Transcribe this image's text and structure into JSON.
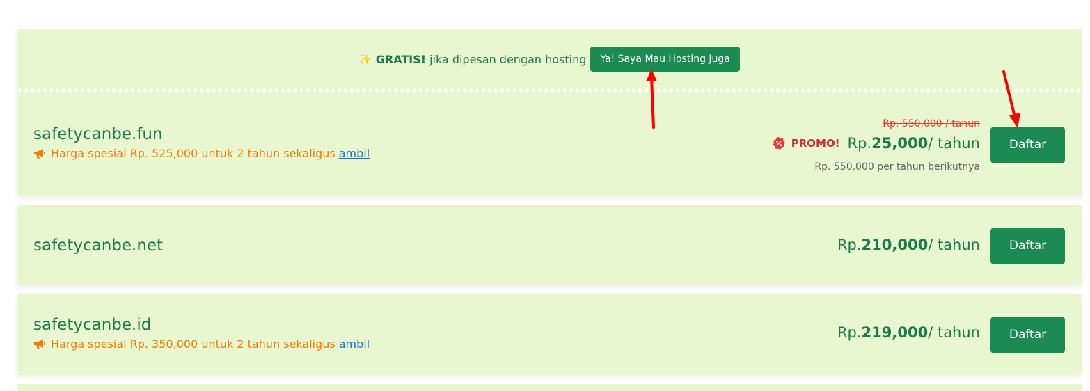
{
  "banner": {
    "icon": "sparkles-icon",
    "highlight": "GRATIS!",
    "text": "jika dipesan dengan hosting",
    "button_label": "Ya! Saya Mau Hosting Juga"
  },
  "domains": [
    {
      "name": "safetycanbe.fun",
      "special_text": "Harga spesial Rp. 525,000 untuk 2 tahun sekaligus",
      "special_link": "ambil",
      "old_price": "Rp. 550,000 / tahun",
      "promo_label": "PROMO!",
      "price_prefix": "Rp.",
      "price_amount": "25,000",
      "price_unit": "/ tahun",
      "renewal_text": "Rp. 550,000 per tahun berikutnya",
      "button_label": "Daftar"
    },
    {
      "name": "safetycanbe.net",
      "price_prefix": "Rp.",
      "price_amount": "210,000",
      "price_unit": "/ tahun",
      "button_label": "Daftar"
    },
    {
      "name": "safetycanbe.id",
      "special_text": "Harga spesial Rp. 350,000 untuk 2 tahun sekaligus",
      "special_link": "ambil",
      "price_prefix": "Rp.",
      "price_amount": "219,000",
      "price_unit": "/ tahun",
      "button_label": "Daftar"
    }
  ],
  "colors": {
    "card_background": "#e8f7cf",
    "primary_green": "#1b8a53",
    "text_green": "#1a7a4a",
    "special_orange": "#f57c00",
    "promo_red": "#d32f2f",
    "link_blue": "#1a6fd8",
    "annotation_red": "#ff0000"
  }
}
